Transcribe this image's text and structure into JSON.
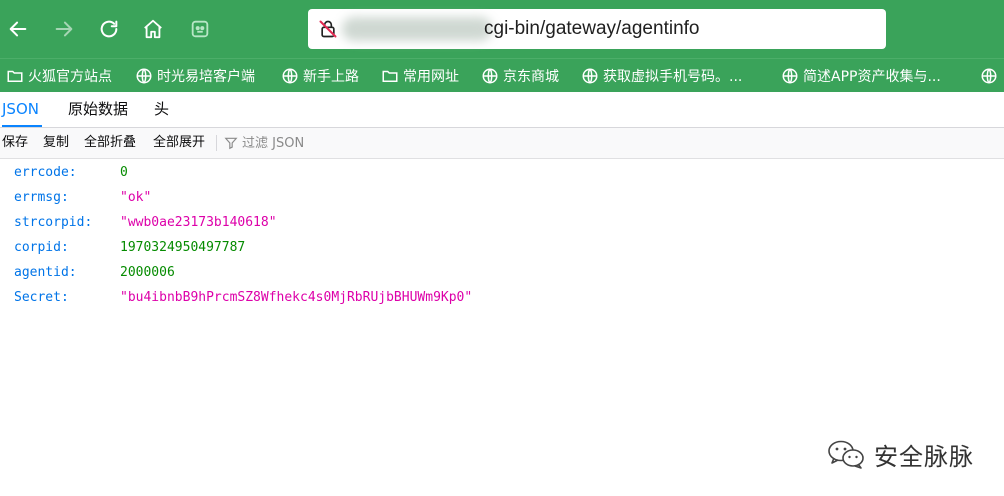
{
  "colors": {
    "toolbar_bg": "#3aa35a",
    "json_key": "#0074e8",
    "json_number": "#058b00",
    "json_string": "#dd00a9",
    "tab_active": "#0a84ff"
  },
  "toolbar": {
    "icons": [
      "back-arrow-icon",
      "forward-arrow-icon",
      "reload-icon",
      "home-icon",
      "extension-icon"
    ],
    "url": "cgi-bin/gateway/agentinfo"
  },
  "bookmarks": [
    {
      "label": "火狐官方站点",
      "icon": "folder-icon"
    },
    {
      "label": "时光易培客户端",
      "icon": "globe-icon"
    },
    {
      "label": "新手上路",
      "icon": "globe-icon"
    },
    {
      "label": "常用网址",
      "icon": "folder-icon"
    },
    {
      "label": "京东商城",
      "icon": "globe-icon"
    },
    {
      "label": "获取虚拟手机号码。...",
      "icon": "globe-icon"
    },
    {
      "label": "简述APP资产收集与...",
      "icon": "globe-icon"
    }
  ],
  "tabs": [
    {
      "label": "JSON",
      "active": true
    },
    {
      "label": "原始数据",
      "active": false
    },
    {
      "label": "头",
      "active": false
    }
  ],
  "actions": {
    "save": "保存",
    "copy": "复制",
    "collapse_all": "全部折叠",
    "expand_all": "全部展开",
    "filter_placeholder": "过滤 JSON"
  },
  "json_rows": [
    {
      "key": "errcode:",
      "value": "0",
      "type": "number"
    },
    {
      "key": "errmsg:",
      "value": "\"ok\"",
      "type": "string"
    },
    {
      "key": "strcorpid:",
      "value": "\"wwb0ae23173b140618\"",
      "type": "string"
    },
    {
      "key": "corpid:",
      "value": "1970324950497787",
      "type": "number"
    },
    {
      "key": "agentid:",
      "value": "2000006",
      "type": "number"
    },
    {
      "key": "Secret:",
      "value": "\"bu4ibnbB9hPrcmSZ8Wfhekc4s0MjRbRUjbBHUWm9Kp0\"",
      "type": "string"
    }
  ],
  "watermark": {
    "icon": "wechat-icon",
    "text": "安全脉脉"
  }
}
